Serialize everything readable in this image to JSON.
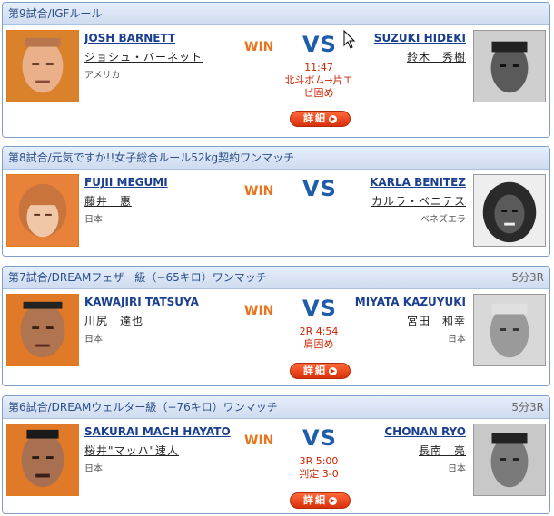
{
  "matches": [
    {
      "title": "第9試合/IGFルール",
      "rules": "",
      "left": {
        "name_en": "JOSH BARNETT",
        "name_jp": "ジョシュ・バーネット",
        "country": "アメリカ"
      },
      "right": {
        "name_en": "SUZUKI HIDEKI",
        "name_jp": "鈴木　秀樹",
        "country": ""
      },
      "win": "WIN",
      "vs": "VS",
      "result": [
        "11:47",
        "北斗ボム→片エ",
        "ビ固め"
      ],
      "detail": "詳細"
    },
    {
      "title": "第8試合/元気ですか!!女子総合ルール52kg契約ワンマッチ",
      "rules": "",
      "left": {
        "name_en": "FUJII MEGUMI",
        "name_jp": "藤井　惠",
        "country": "日本"
      },
      "right": {
        "name_en": "KARLA BENITEZ",
        "name_jp": "カルラ・ベニテス",
        "country": "ベネズエラ"
      },
      "win": "WIN",
      "vs": "VS",
      "result": [],
      "detail": ""
    },
    {
      "title": "第7試合/DREAMフェザー級（−65キロ）ワンマッチ",
      "rules": "5分3R",
      "left": {
        "name_en": "KAWAJIRI TATSUYA",
        "name_jp": "川尻　達也",
        "country": "日本"
      },
      "right": {
        "name_en": "MIYATA KAZUYUKI",
        "name_jp": "宮田　和幸",
        "country": "日本"
      },
      "win": "WIN",
      "vs": "VS",
      "result": [
        "2R 4:54",
        "肩固め"
      ],
      "detail": "詳細"
    },
    {
      "title": "第6試合/DREAMウェルター級（−76キロ）ワンマッチ",
      "rules": "5分3R",
      "left": {
        "name_en": "SAKURAI MACH HAYATO",
        "name_jp": "桜井\"マッハ\"速人",
        "country": "日本"
      },
      "right": {
        "name_en": "CHONAN RYO",
        "name_jp": "長南　亮",
        "country": "日本"
      },
      "win": "WIN",
      "vs": "VS",
      "result": [
        "3R 5:00",
        "判定 3-0"
      ],
      "detail": "詳細"
    }
  ],
  "colors": {
    "win": "#e8761e",
    "vs": "#1f5daa",
    "result": "#cc2200",
    "link": "#1a3f8f"
  }
}
